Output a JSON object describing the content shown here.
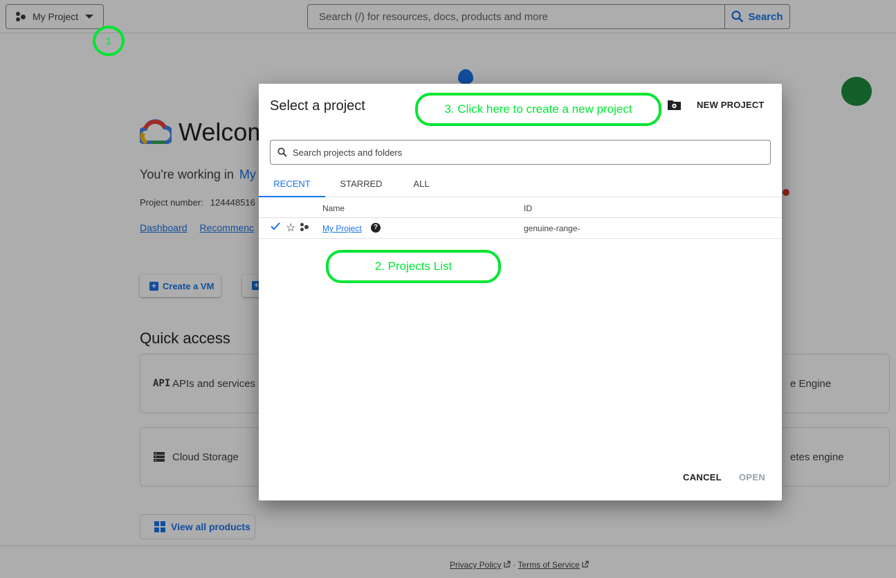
{
  "topbar": {
    "project_picker_label": "My Project",
    "search_placeholder": "Search (/) for resources, docs, products and more",
    "search_button": "Search"
  },
  "background": {
    "welcome": "Welcom",
    "working_prefix": "You're working in",
    "working_project": "My",
    "project_number_label": "Project number:",
    "project_number_value": "124448516",
    "links": [
      "Dashboard",
      "Recommenc"
    ],
    "create_vm": "Create a VM",
    "quick_access_title": "Quick access",
    "cards": [
      {
        "icon": "API",
        "label": "APIs and services"
      },
      {
        "icon": "storage",
        "label": "Cloud Storage"
      },
      {
        "icon": "",
        "label": "e Engine"
      },
      {
        "icon": "",
        "label": "etes engine"
      }
    ],
    "view_all": "View all products",
    "footer": {
      "privacy": "Privacy Policy",
      "separator": "·",
      "terms": "Terms of Service"
    }
  },
  "dialog": {
    "title": "Select a project",
    "new_project": "NEW PROJECT",
    "search_placeholder": "Search projects and folders",
    "tabs": [
      "RECENT",
      "STARRED",
      "ALL"
    ],
    "active_tab": "RECENT",
    "columns": {
      "name": "Name",
      "id": "ID"
    },
    "rows": [
      {
        "name": "My Project",
        "id": "genuine-range-",
        "selected": true
      }
    ],
    "cancel": "CANCEL",
    "open": "OPEN"
  },
  "annotations": {
    "step1": "1",
    "step2": "2. Projects List",
    "step3": "3. Click here to create a new project",
    "color": "#00e533"
  },
  "colors": {
    "accent": "#1a73e8",
    "scrim": "rgba(0,0,0,0.32)"
  }
}
